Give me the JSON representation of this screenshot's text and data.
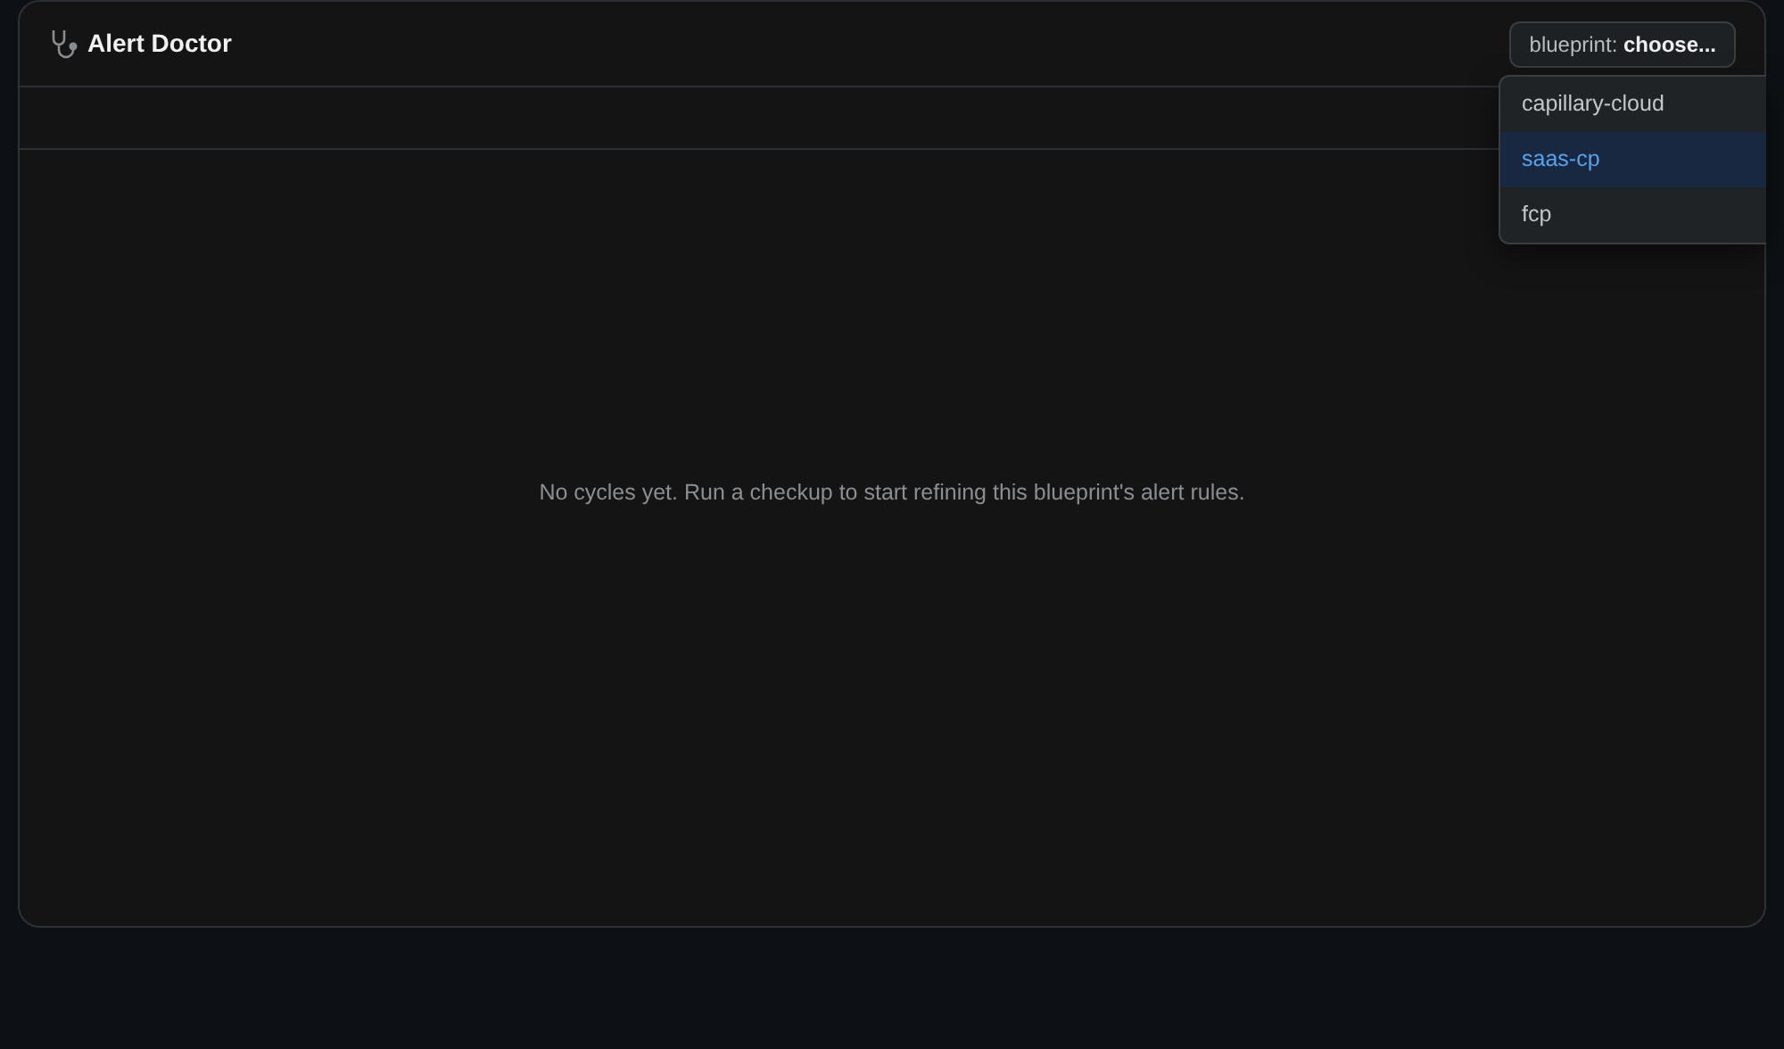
{
  "app": {
    "title": "Alert Doctor"
  },
  "blueprint_picker": {
    "label": "blueprint: **choose...**",
    "expanded": true,
    "options": [
      {
        "label": "capillary-cloud",
        "selected": false
      },
      {
        "label": "saas-cp",
        "selected": true
      },
      {
        "label": "fcp",
        "selected": false
      }
    ]
  },
  "empty_state": "No cycles yet. Run a checkup to start refining this blueprint's alert rules."
}
